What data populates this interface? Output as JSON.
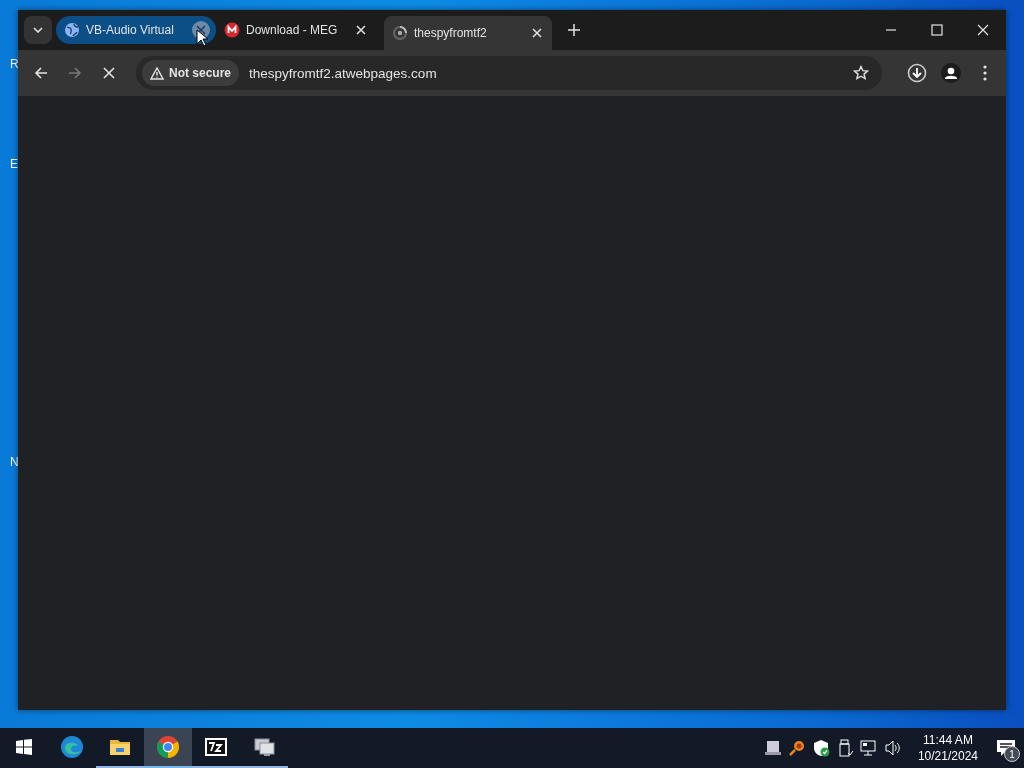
{
  "desktop": {
    "icon_labels": [
      "R",
      "E",
      "N"
    ]
  },
  "browser": {
    "tabs": [
      {
        "title": "VB-Audio Virtual",
        "selected": false,
        "highlighted": true,
        "kind": "globe"
      },
      {
        "title": "Download - MEG",
        "selected": false,
        "highlighted": false,
        "kind": "mega"
      },
      {
        "title": "thespyfromtf2",
        "selected": true,
        "highlighted": false,
        "kind": "spinner"
      }
    ],
    "loading": true,
    "address_bar": {
      "security": "Not secure",
      "url": "thespyfromtf2.atwebpages.com"
    }
  },
  "taskbar": {
    "apps": [
      {
        "kind": "edge",
        "running": false,
        "selected": false
      },
      {
        "kind": "explorer",
        "running": true,
        "selected": false
      },
      {
        "kind": "chrome",
        "running": true,
        "selected": true
      },
      {
        "kind": "sevenzip",
        "running": true,
        "selected": false
      },
      {
        "kind": "monitor",
        "running": true,
        "selected": false
      }
    ],
    "clock": {
      "time": "11:44 AM",
      "date": "10/21/2024"
    },
    "notification_count": "1"
  }
}
